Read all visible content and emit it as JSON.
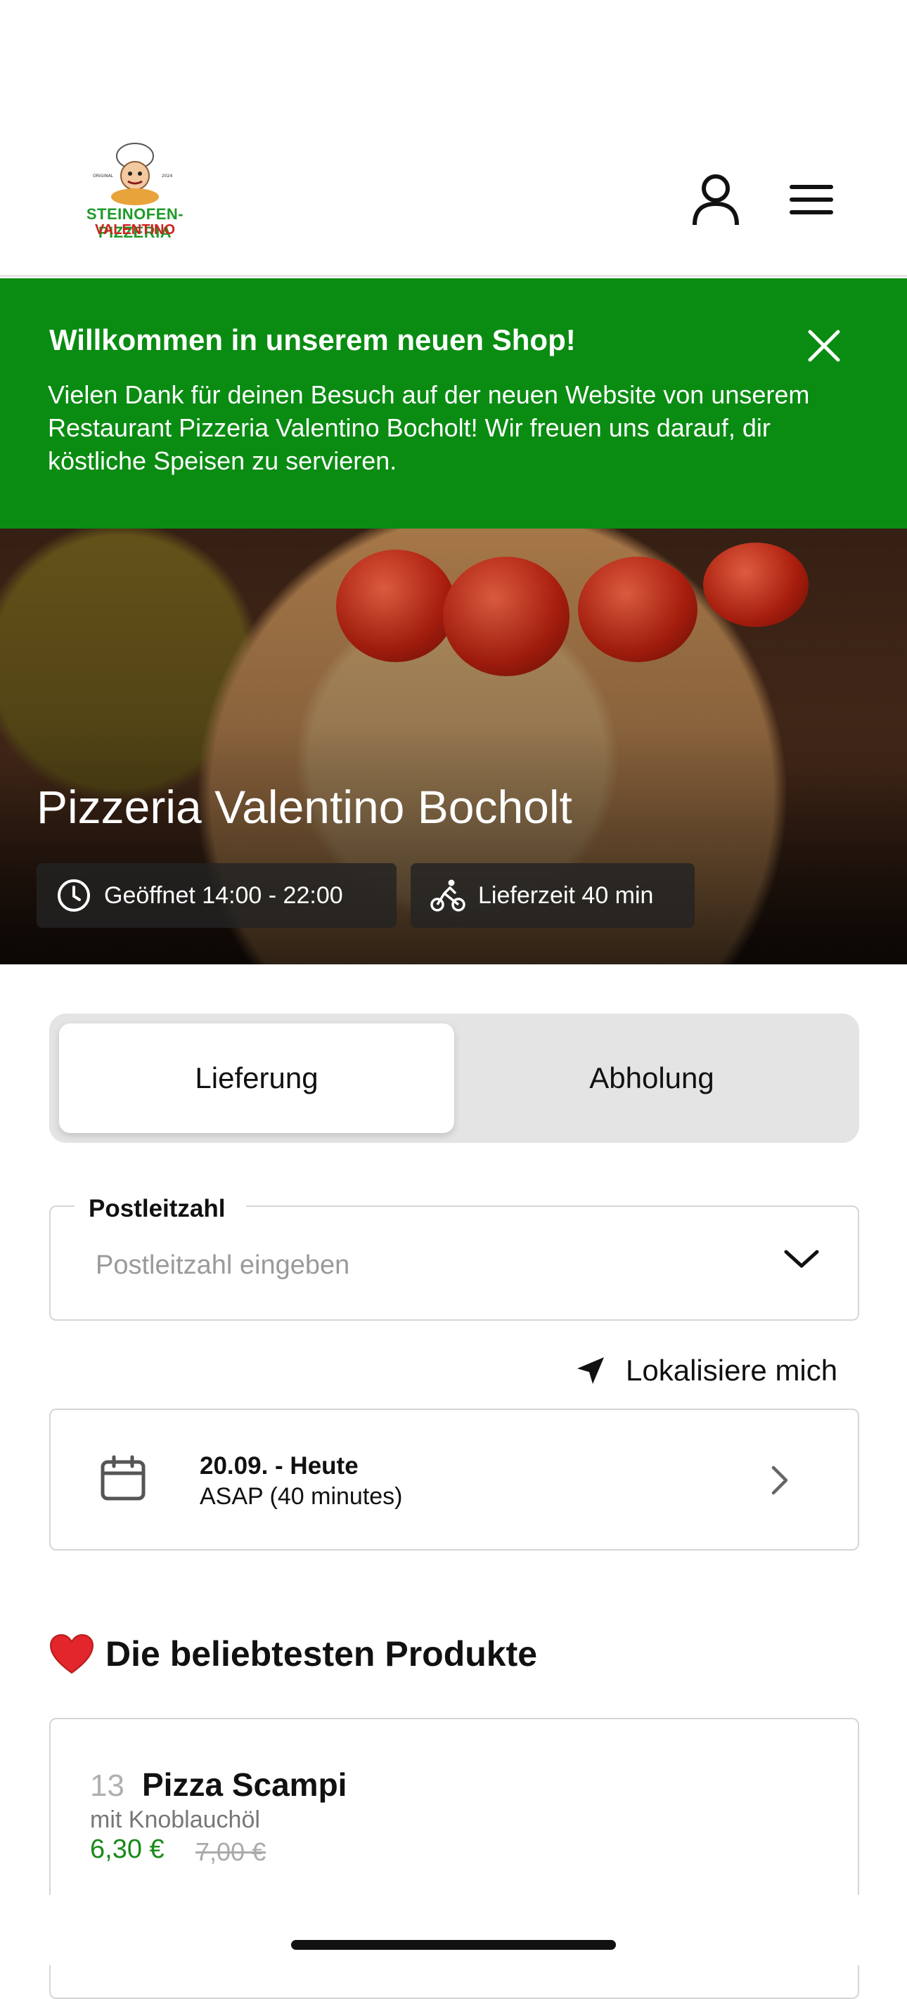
{
  "header": {
    "logo_line1": "STEINOFEN-PIZZERIA",
    "logo_line2": "VALENTINO",
    "account_icon": "user-icon",
    "menu_icon": "hamburger-menu-icon"
  },
  "banner": {
    "title": "Willkommen in unserem neuen Shop!",
    "text": "Vielen Dank für deinen Besuch auf der neuen Website von unserem Restaurant Pizzeria Valentino Bocholt! Wir freuen uns darauf, dir köstliche Speisen zu servieren.",
    "close_icon": "close-icon",
    "color": "#0a8c12"
  },
  "hero": {
    "title": "Pizzeria Valentino Bocholt",
    "opening_hours": "Geöffnet 14:00 - 22:00",
    "delivery_time": "Lieferzeit 40 min"
  },
  "order_type": {
    "options": [
      "Lieferung",
      "Abholung"
    ],
    "selected": "Lieferung"
  },
  "postcode": {
    "label": "Postleitzahl",
    "placeholder": "Postleitzahl eingeben"
  },
  "locate": {
    "label": "Lokalisiere mich"
  },
  "date_picker": {
    "date": "20.09. - Heute",
    "time": "ASAP (40 minutes)"
  },
  "popular": {
    "title": "Die beliebtesten Produkte",
    "products": [
      {
        "number": "13",
        "name": "Pizza Scampi",
        "description": "mit Knoblauchöl",
        "price": "6,30 €",
        "old_price": "7,00 €"
      }
    ]
  },
  "colors": {
    "accent_green": "#0a8c12",
    "price_green": "#1a8a1a"
  }
}
